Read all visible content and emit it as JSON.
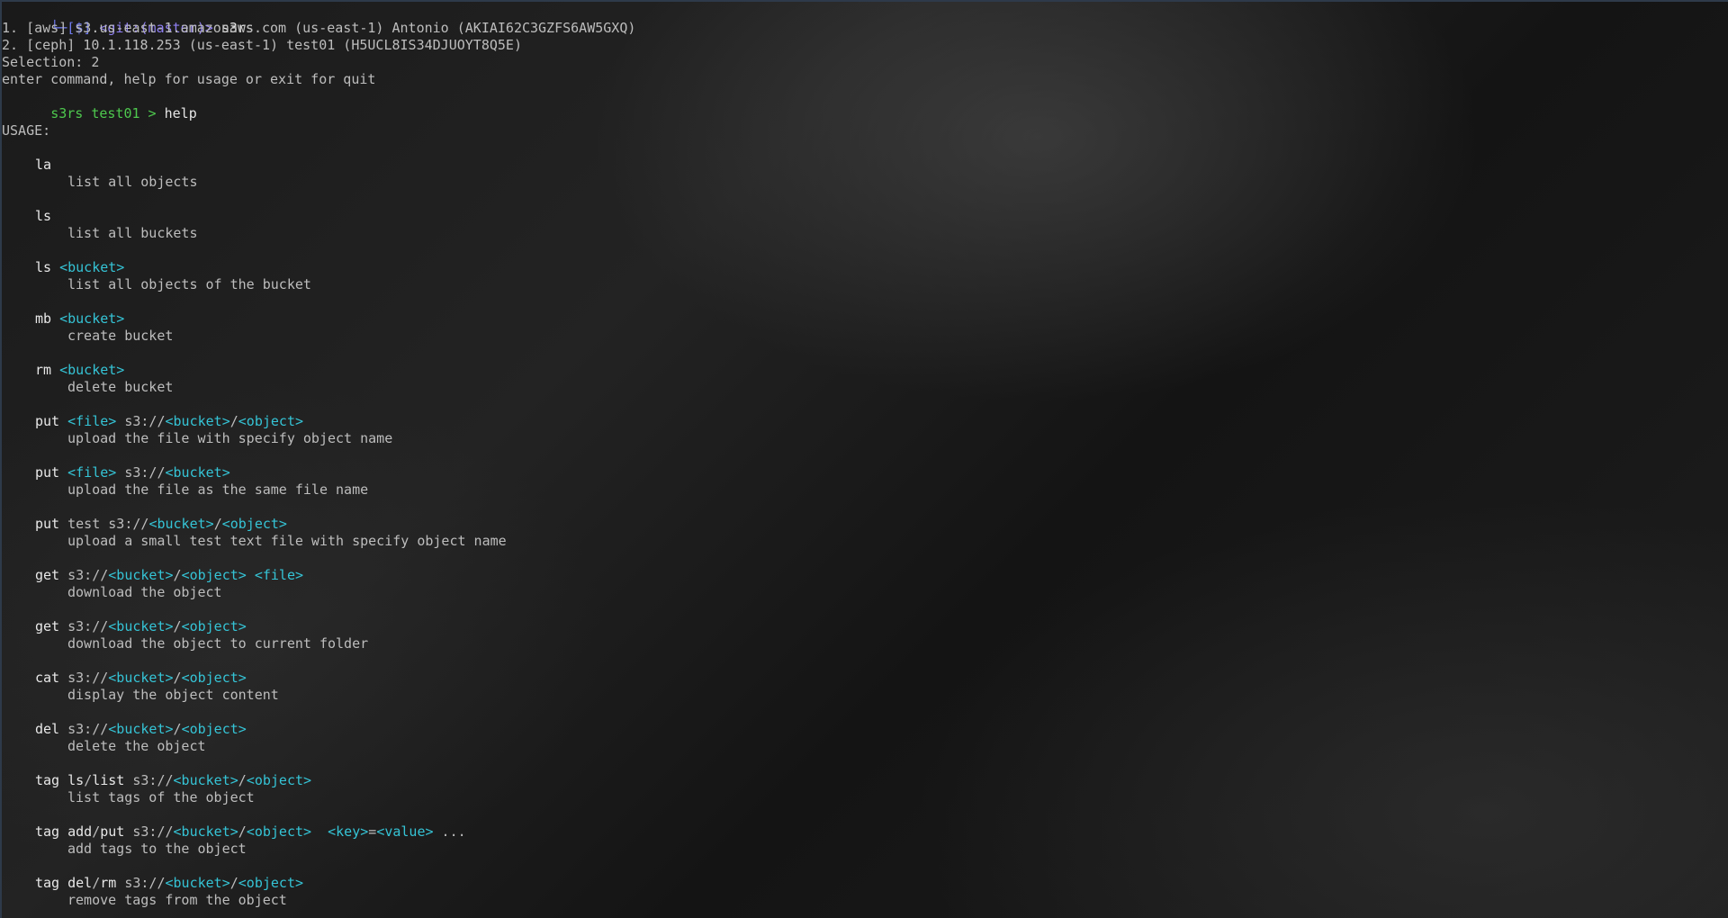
{
  "prompt": {
    "corner": "└─",
    "open": "[",
    "dollar": "$",
    "close": "]",
    "git": "<git:(master)>",
    "command": "s3rs"
  },
  "profiles": [
    "1. [aws] s3.us-east-1.amazonaws.com (us-east-1) Antonio (AKIAI62C3GZFS6AW5GXQ)",
    "2. [ceph] 10.1.118.253 (us-east-1) test01 (H5UCL8IS34DJUOYT8Q5E)"
  ],
  "selection": "Selection: 2",
  "instructions": "enter command, help for usage or exit for quit",
  "s3rs_prompt": "s3rs test01 > ",
  "s3rs_command": "help",
  "usage_title": "USAGE:",
  "commands": [
    {
      "parts": [
        {
          "t": "la",
          "c": "cmd"
        }
      ],
      "desc": "list all objects"
    },
    {
      "parts": [
        {
          "t": "ls",
          "c": "cmd"
        }
      ],
      "desc": "list all buckets"
    },
    {
      "parts": [
        {
          "t": "ls ",
          "c": "cmd"
        },
        {
          "t": "<bucket>",
          "c": "arg"
        }
      ],
      "desc": "list all objects of the bucket"
    },
    {
      "parts": [
        {
          "t": "mb ",
          "c": "cmd"
        },
        {
          "t": "<bucket>",
          "c": "arg"
        }
      ],
      "desc": "create bucket"
    },
    {
      "parts": [
        {
          "t": "rm ",
          "c": "cmd"
        },
        {
          "t": "<bucket>",
          "c": "arg"
        }
      ],
      "desc": "delete bucket"
    },
    {
      "parts": [
        {
          "t": "put ",
          "c": "cmd"
        },
        {
          "t": "<file>",
          "c": "arg"
        },
        {
          "t": " s3://",
          "c": "muted"
        },
        {
          "t": "<bucket>",
          "c": "arg"
        },
        {
          "t": "/",
          "c": "muted"
        },
        {
          "t": "<object>",
          "c": "arg"
        }
      ],
      "desc": "upload the file with specify object name"
    },
    {
      "parts": [
        {
          "t": "put ",
          "c": "cmd"
        },
        {
          "t": "<file>",
          "c": "arg"
        },
        {
          "t": " s3://",
          "c": "muted"
        },
        {
          "t": "<bucket>",
          "c": "arg"
        }
      ],
      "desc": "upload the file as the same file name"
    },
    {
      "parts": [
        {
          "t": "put ",
          "c": "cmd"
        },
        {
          "t": "test s3://",
          "c": "muted"
        },
        {
          "t": "<bucket>",
          "c": "arg"
        },
        {
          "t": "/",
          "c": "muted"
        },
        {
          "t": "<object>",
          "c": "arg"
        }
      ],
      "desc": "upload a small test text file with specify object name"
    },
    {
      "parts": [
        {
          "t": "get ",
          "c": "cmd"
        },
        {
          "t": "s3://",
          "c": "muted"
        },
        {
          "t": "<bucket>",
          "c": "arg"
        },
        {
          "t": "/",
          "c": "muted"
        },
        {
          "t": "<object>",
          "c": "arg"
        },
        {
          "t": " ",
          "c": "muted"
        },
        {
          "t": "<file>",
          "c": "arg"
        }
      ],
      "desc": "download the object"
    },
    {
      "parts": [
        {
          "t": "get ",
          "c": "cmd"
        },
        {
          "t": "s3://",
          "c": "muted"
        },
        {
          "t": "<bucket>",
          "c": "arg"
        },
        {
          "t": "/",
          "c": "muted"
        },
        {
          "t": "<object>",
          "c": "arg"
        }
      ],
      "desc": "download the object to current folder"
    },
    {
      "parts": [
        {
          "t": "cat ",
          "c": "cmd"
        },
        {
          "t": "s3://",
          "c": "muted"
        },
        {
          "t": "<bucket>",
          "c": "arg"
        },
        {
          "t": "/",
          "c": "muted"
        },
        {
          "t": "<object>",
          "c": "arg"
        }
      ],
      "desc": "display the object content"
    },
    {
      "parts": [
        {
          "t": "del ",
          "c": "cmd"
        },
        {
          "t": "s3://",
          "c": "muted"
        },
        {
          "t": "<bucket>",
          "c": "arg"
        },
        {
          "t": "/",
          "c": "muted"
        },
        {
          "t": "<object>",
          "c": "arg"
        }
      ],
      "desc": "delete the object"
    },
    {
      "parts": [
        {
          "t": "tag ",
          "c": "cmd"
        },
        {
          "t": "ls",
          "c": "cmd"
        },
        {
          "t": "/",
          "c": "muted"
        },
        {
          "t": "list",
          "c": "cmd"
        },
        {
          "t": " s3://",
          "c": "muted"
        },
        {
          "t": "<bucket>",
          "c": "arg"
        },
        {
          "t": "/",
          "c": "muted"
        },
        {
          "t": "<object>",
          "c": "arg"
        }
      ],
      "desc": "list tags of the object"
    },
    {
      "parts": [
        {
          "t": "tag ",
          "c": "cmd"
        },
        {
          "t": "add",
          "c": "cmd"
        },
        {
          "t": "/",
          "c": "muted"
        },
        {
          "t": "put",
          "c": "cmd"
        },
        {
          "t": " s3://",
          "c": "muted"
        },
        {
          "t": "<bucket>",
          "c": "arg"
        },
        {
          "t": "/",
          "c": "muted"
        },
        {
          "t": "<object>",
          "c": "arg"
        },
        {
          "t": "  ",
          "c": "muted"
        },
        {
          "t": "<key>",
          "c": "arg"
        },
        {
          "t": "=",
          "c": "muted"
        },
        {
          "t": "<value>",
          "c": "arg"
        },
        {
          "t": " ...",
          "c": "muted"
        }
      ],
      "desc": "add tags to the object"
    },
    {
      "parts": [
        {
          "t": "tag ",
          "c": "cmd"
        },
        {
          "t": "del",
          "c": "cmd"
        },
        {
          "t": "/",
          "c": "muted"
        },
        {
          "t": "rm",
          "c": "cmd"
        },
        {
          "t": " s3://",
          "c": "muted"
        },
        {
          "t": "<bucket>",
          "c": "arg"
        },
        {
          "t": "/",
          "c": "muted"
        },
        {
          "t": "<object>",
          "c": "arg"
        }
      ],
      "desc": "remove tags from the object"
    }
  ]
}
